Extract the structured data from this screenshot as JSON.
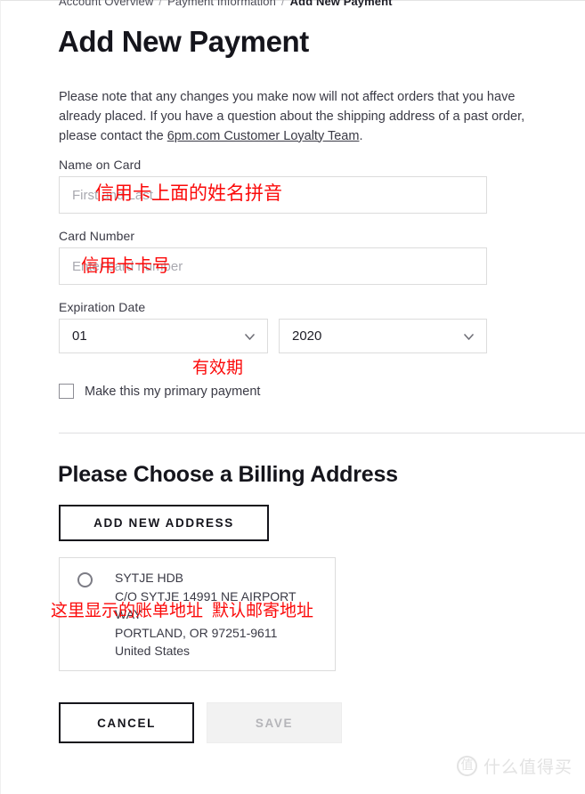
{
  "breadcrumb": {
    "item1": "Account Overview",
    "separator": "/",
    "item2": "Payment Information",
    "current": "Add New Payment"
  },
  "page_title": "Add New Payment",
  "intro": {
    "text_before": "Please note that any changes you make now will not affect orders that you have already placed. If you have a question about the shipping address of a past order, please contact the ",
    "link_text": "6pm.com Customer Loyalty Team",
    "text_after": "."
  },
  "form": {
    "name_on_card": {
      "label": "Name on Card",
      "placeholder": "First and Last",
      "value": ""
    },
    "card_number": {
      "label": "Card Number",
      "placeholder": "Enter card number",
      "value": ""
    },
    "expiration": {
      "label": "Expiration Date",
      "month_value": "01",
      "year_value": "2020",
      "month_icon": "chevron-down-icon",
      "year_icon": "chevron-down-icon"
    },
    "primary_checkbox": {
      "label": "Make this my primary payment",
      "checked": false
    }
  },
  "billing": {
    "section_title": "Please Choose a Billing Address",
    "add_new_address_label": "ADD NEW ADDRESS",
    "address": {
      "selected": false,
      "line1": "SYTJE HDB",
      "line2": "C/O SYTJE 14991 NE AIRPORT",
      "line3": "WAY",
      "line4": "PORTLAND, OR 97251-9611",
      "line5": "United States"
    }
  },
  "actions": {
    "cancel_label": "CANCEL",
    "save_label": "SAVE",
    "save_disabled": true
  },
  "annotations": {
    "color": "#fb0a0a",
    "name_on_card": "信用卡上面的姓名拼音",
    "card_number": "信用卡卡号",
    "expiration": "有效期",
    "address_part1": "这里显示的账单地址",
    "address_part2": "默认邮寄地址"
  },
  "watermark": {
    "logo_char": "值",
    "text": "什么值得买"
  }
}
